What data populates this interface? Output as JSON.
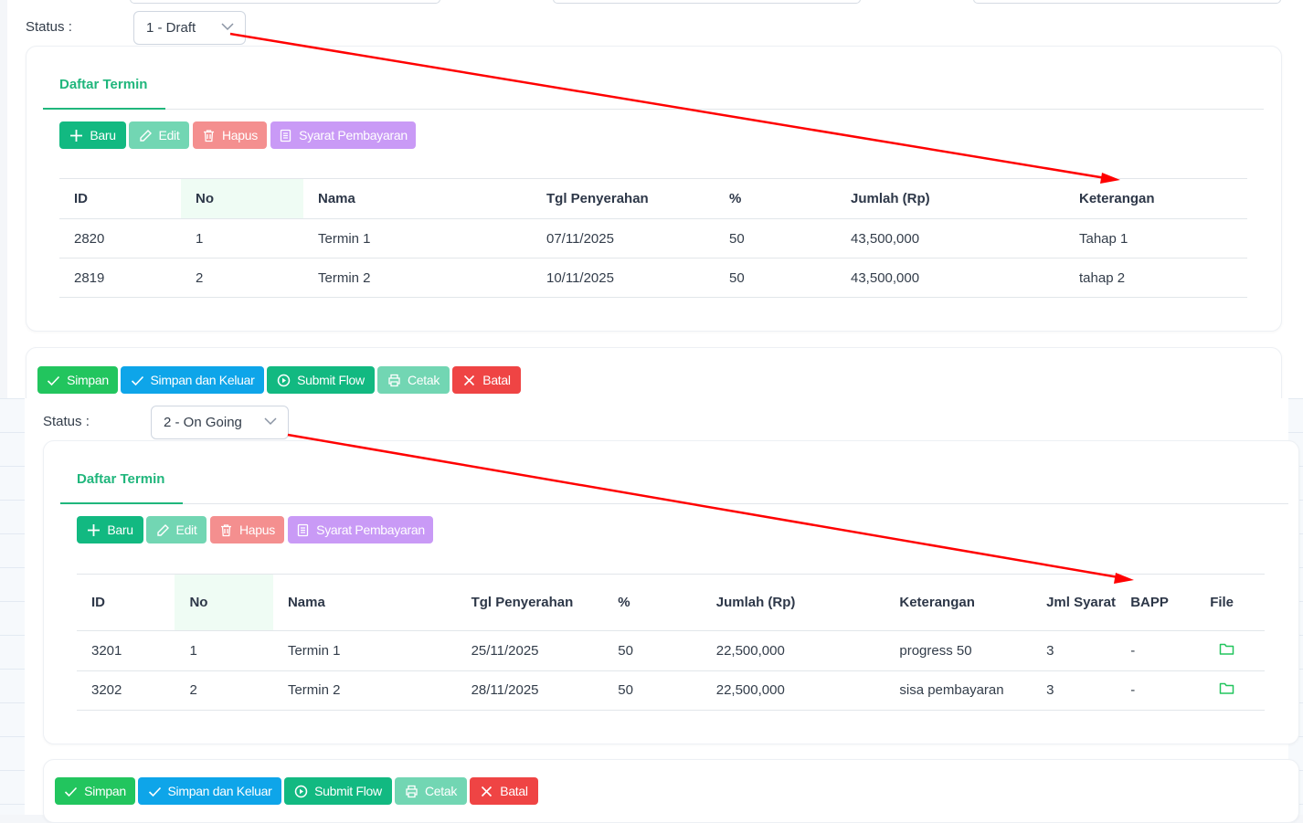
{
  "panels": [
    {
      "status_label": "Status :",
      "status_value": "1 - Draft",
      "tab": "Daftar Termin",
      "toolbar": {
        "baru": "Baru",
        "edit": "Edit",
        "hapus": "Hapus",
        "syarat": "Syarat Pembayaran"
      },
      "columns": [
        "ID",
        "No",
        "Nama",
        "Tgl Penyerahan",
        "%",
        "Jumlah (Rp)",
        "Keterangan"
      ],
      "rows": [
        [
          "2820",
          "1",
          "Termin 1",
          "07/11/2025",
          "50",
          "43,500,000",
          "Tahap 1"
        ],
        [
          "2819",
          "2",
          "Termin 2",
          "10/11/2025",
          "50",
          "43,500,000",
          "tahap 2"
        ]
      ],
      "actions": {
        "simpan": "Simpan",
        "simpan_keluar": "Simpan dan Keluar",
        "submit": "Submit Flow",
        "cetak": "Cetak",
        "batal": "Batal"
      }
    },
    {
      "status_label": "Status :",
      "status_value": "2 - On Going",
      "tab": "Daftar Termin",
      "toolbar": {
        "baru": "Baru",
        "edit": "Edit",
        "hapus": "Hapus",
        "syarat": "Syarat Pembayaran"
      },
      "columns": [
        "ID",
        "No",
        "Nama",
        "Tgl Penyerahan",
        "%",
        "Jumlah (Rp)",
        "Keterangan",
        "Jml Syarat",
        "BAPP",
        "File"
      ],
      "rows": [
        [
          "3201",
          "1",
          "Termin 1",
          "25/11/2025",
          "50",
          "22,500,000",
          "progress 50",
          "3",
          "-",
          "folder-icon"
        ],
        [
          "3202",
          "2",
          "Termin 2",
          "28/11/2025",
          "50",
          "22,500,000",
          "sisa pembayaran",
          "3",
          "-",
          "folder-icon"
        ]
      ],
      "actions": {
        "simpan": "Simpan",
        "simpan_keluar": "Simpan dan Keluar",
        "submit": "Submit Flow",
        "cetak": "Cetak",
        "batal": "Batal"
      }
    }
  ],
  "colors": {
    "accent": "#20b67c",
    "arrow": "#ff0000"
  }
}
